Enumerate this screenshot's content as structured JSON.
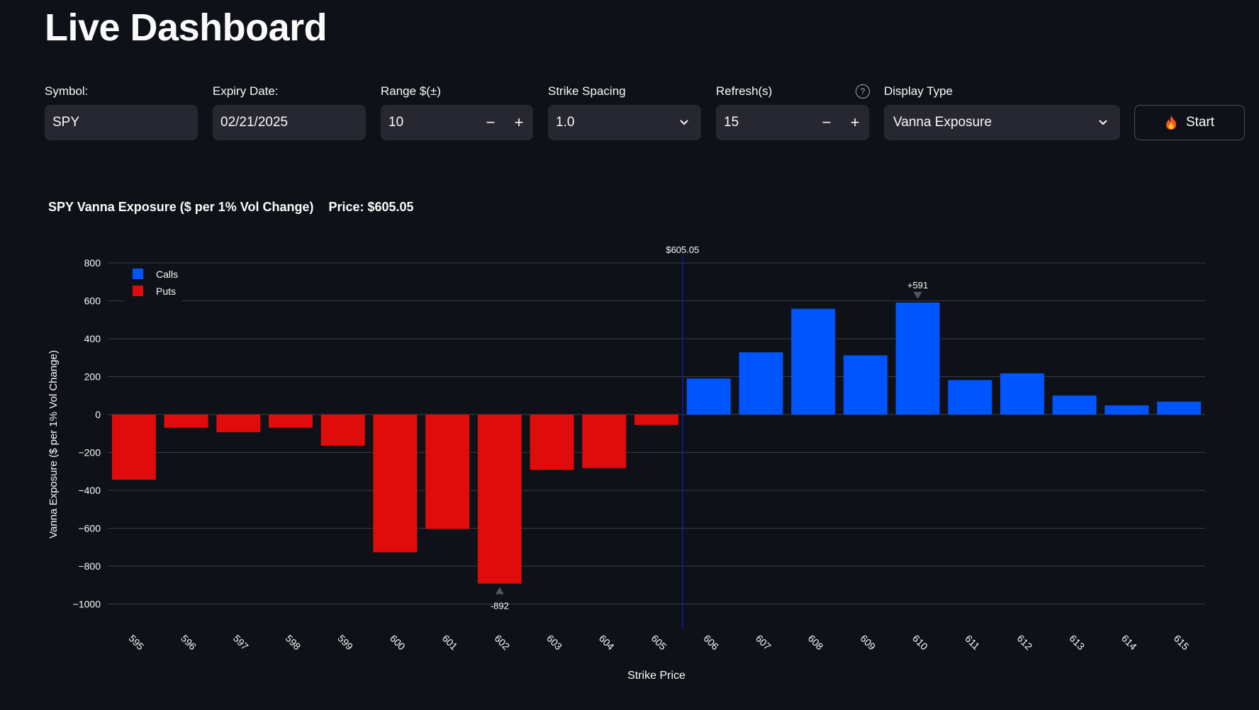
{
  "page": {
    "title": "Live Dashboard"
  },
  "controls": {
    "symbol": {
      "label": "Symbol:",
      "value": "SPY"
    },
    "expiry": {
      "label": "Expiry Date:",
      "value": "02/21/2025"
    },
    "range": {
      "label": "Range $(±)",
      "value": "10",
      "minus": "−",
      "plus": "+"
    },
    "strike_spacing": {
      "label": "Strike Spacing",
      "value": "1.0"
    },
    "refresh": {
      "label": "Refresh(s)",
      "value": "15",
      "minus": "−",
      "plus": "+",
      "help": "?"
    },
    "display_type": {
      "label": "Display Type",
      "value": "Vanna Exposure"
    },
    "start": {
      "label": "Start",
      "icon": "fire-icon"
    }
  },
  "chart_heading": {
    "title": "SPY Vanna Exposure ($ per 1% Vol Change)",
    "price": "Price: $605.05"
  },
  "colors": {
    "calls": "#0055ff",
    "puts": "#e00b0b",
    "price_line": "#0b1db0",
    "background": "#0e1117"
  },
  "chart_data": {
    "type": "bar",
    "xlabel": "Strike Price",
    "ylabel": "Vanna Exposure ($ per 1% Vol Change)",
    "ylim": [
      -1130,
      800
    ],
    "yticks": [
      800,
      600,
      400,
      200,
      0,
      -200,
      -400,
      -600,
      -800,
      -1000
    ],
    "ytick_labels": [
      "800",
      "600",
      "400",
      "200",
      "0",
      "−200",
      "−400",
      "−600",
      "−800",
      "−1000"
    ],
    "grid": true,
    "legend_position": "top-left",
    "categories": [
      "595",
      "596",
      "597",
      "598",
      "599",
      "600",
      "601",
      "602",
      "603",
      "604",
      "605",
      "606",
      "607",
      "608",
      "609",
      "610",
      "611",
      "612",
      "613",
      "614",
      "615"
    ],
    "series": [
      {
        "name": "Calls",
        "color": "#0055ff",
        "values": [
          0,
          0,
          0,
          0,
          0,
          0,
          0,
          0,
          0,
          0,
          0,
          190,
          328,
          558,
          312,
          591,
          182,
          217,
          100,
          48,
          68
        ]
      },
      {
        "name": "Puts",
        "color": "#e00b0b",
        "values": [
          -344,
          -70,
          -93,
          -70,
          -165,
          -727,
          -604,
          -892,
          -292,
          -283,
          -55,
          0,
          0,
          0,
          0,
          0,
          0,
          0,
          0,
          0,
          0
        ]
      }
    ],
    "price_marker": {
      "x": 605.5,
      "label": "$605.05"
    },
    "annotations": [
      {
        "category": "610",
        "value": 591,
        "text": "+591"
      },
      {
        "category": "602",
        "value": -892,
        "text": "-892"
      }
    ]
  }
}
